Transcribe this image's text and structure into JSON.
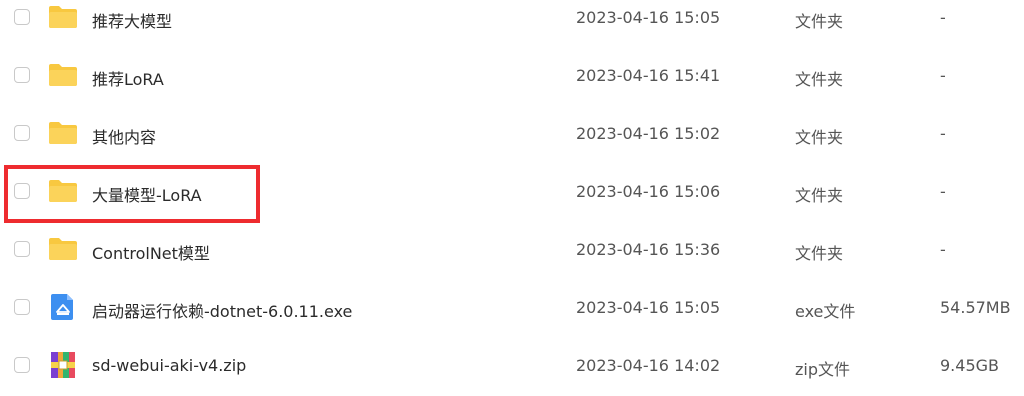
{
  "files": [
    {
      "name": "推荐大模型",
      "date": "2023-04-16 15:05",
      "type": "文件夹",
      "size": "-",
      "icon": "folder-icon"
    },
    {
      "name": "推荐LoRA",
      "date": "2023-04-16 15:41",
      "type": "文件夹",
      "size": "-",
      "icon": "folder-icon"
    },
    {
      "name": "其他内容",
      "date": "2023-04-16 15:02",
      "type": "文件夹",
      "size": "-",
      "icon": "folder-icon"
    },
    {
      "name": "大量模型-LoRA",
      "date": "2023-04-16 15:06",
      "type": "文件夹",
      "size": "-",
      "icon": "folder-icon"
    },
    {
      "name": "ControlNet模型",
      "date": "2023-04-16 15:36",
      "type": "文件夹",
      "size": "-",
      "icon": "folder-icon"
    },
    {
      "name": "启动器运行依赖-dotnet-6.0.11.exe",
      "date": "2023-04-16 15:05",
      "type": "exe文件",
      "size": "54.57MB",
      "icon": "exe-file-icon"
    },
    {
      "name": "sd-webui-aki-v4.zip",
      "date": "2023-04-16 14:02",
      "type": "zip文件",
      "size": "9.45GB",
      "icon": "zip-archive-icon"
    }
  ],
  "colors": {
    "folder": "#f8c840",
    "highlight": "#ee2b2f",
    "exe_icon": "#3d8ff0",
    "text": "#2b2b2b"
  }
}
